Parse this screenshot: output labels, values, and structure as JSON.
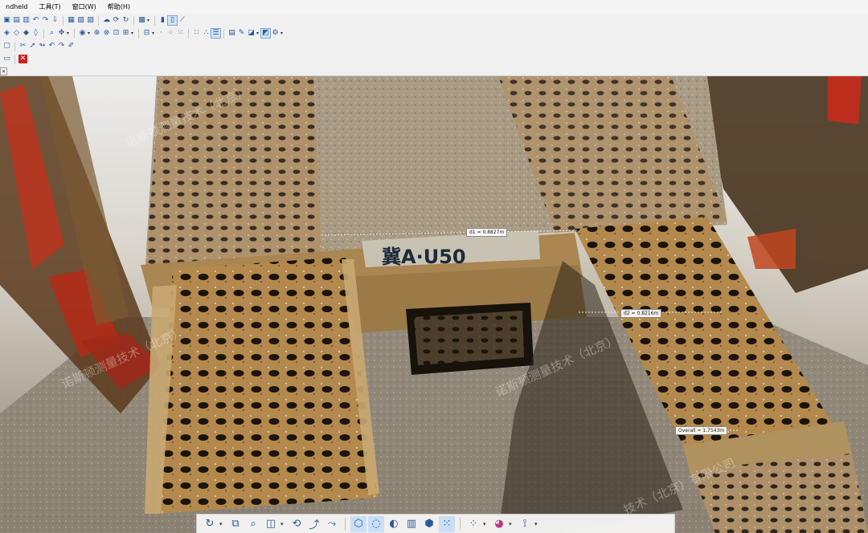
{
  "menu": {
    "app_fragment": "ndheld",
    "items": [
      "工具(T)",
      "窗口(W)",
      "帮助(H)"
    ]
  },
  "icons": {
    "row1": [
      "save-icon",
      "open-icon",
      "print-icon",
      "undo-icon",
      "redo-icon",
      "import-icon",
      "window-icon",
      "panel-icon",
      "layers-icon",
      "cloud-icon",
      "sync-icon",
      "refresh-icon",
      "display-icon",
      "chart-icon",
      "properties-icon",
      "ruler-icon"
    ],
    "row2": [
      "cube-icon",
      "cube-front-icon",
      "cube-side-icon",
      "cube-top-icon",
      "zoom-icon",
      "pan-icon",
      "camera-icon",
      "move-icon",
      "rotate-icon",
      "crop-icon",
      "select-icon",
      "grid-icon",
      "point-icon",
      "points-icon",
      "dots-icon",
      "dots-small-icon",
      "dots-large-icon",
      "list-icon",
      "table-icon",
      "pencil-icon",
      "shape-icon",
      "cube-view-icon",
      "settings-icon"
    ],
    "row3": [
      "window-small-icon",
      "scissors-icon",
      "cursor-icon",
      "lasso-icon",
      "undo-small-icon",
      "redo-small-icon",
      "brush-icon"
    ],
    "row4": [
      "panel-toggle-icon",
      "close-icon"
    ],
    "bottom": [
      "orbit-icon",
      "fit-view-icon",
      "zoom-icon",
      "view-cube-icon",
      "rotate-icon",
      "walk-icon",
      "fly-icon",
      "box-icon",
      "isolate-icon",
      "clip-icon",
      "slice-icon",
      "section-icon",
      "point-size-icon",
      "point-density-icon",
      "color-icon",
      "measure-icon"
    ]
  },
  "measurements": {
    "d1": "d1 = 0.8827m",
    "d2": "d2 = 0.8216m",
    "overall": "Overall = 1.7543m"
  },
  "watermark": {
    "line1": "诺斯顿测量技术（北京）",
    "line2": "诺斯顿测量技术（北京）",
    "line3": "诺斯顿测量技术（北京）",
    "line4": "技术（北京）有限公司"
  },
  "plate_text": "冀A·U50"
}
